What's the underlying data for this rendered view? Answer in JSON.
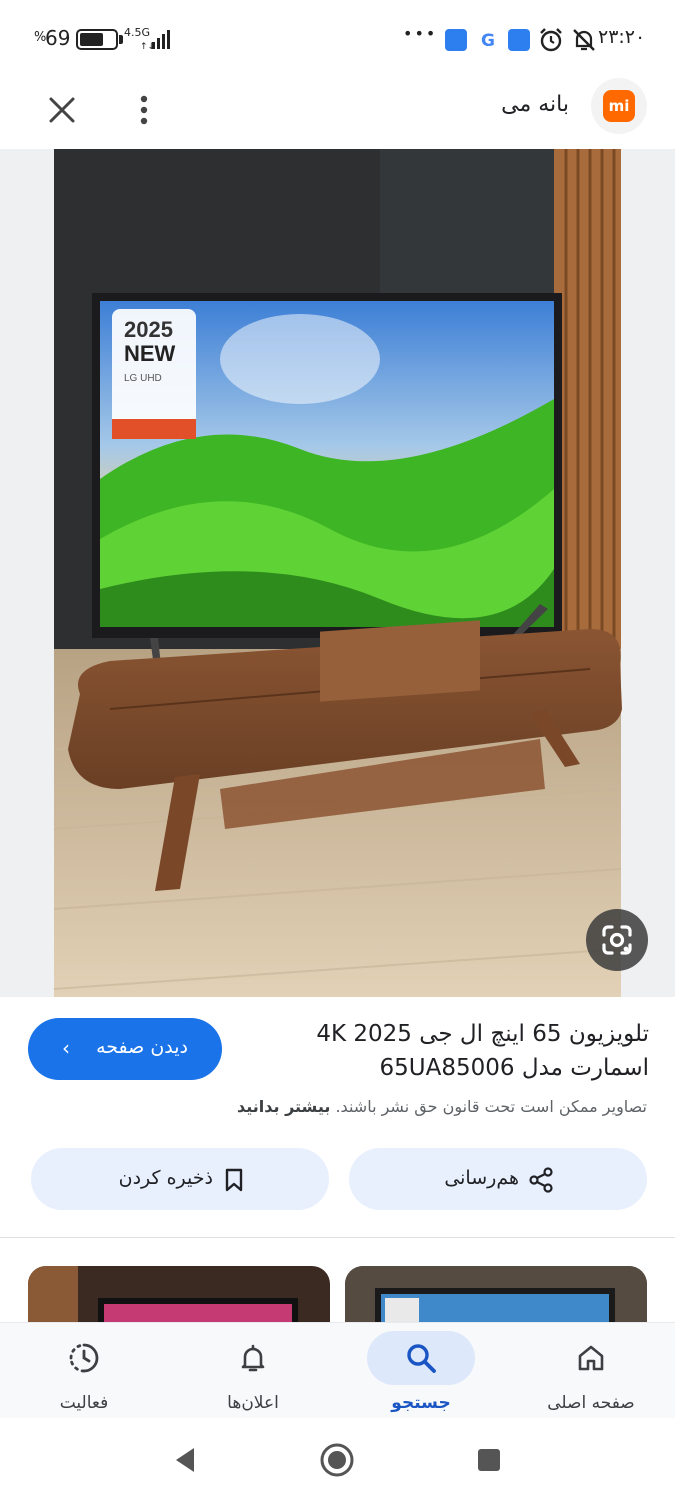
{
  "status_bar": {
    "battery_percent": "69",
    "percent_sign": "%",
    "battery_level": 0.69,
    "network_type": "4.5G",
    "overflow_dots": "•••",
    "time": "۲۳:۲۰",
    "icons": [
      "battery-icon",
      "signal-icon",
      "dots-icon",
      "app-notification-icon",
      "google-icon",
      "app-notification-icon",
      "alarm-icon",
      "mute-icon"
    ]
  },
  "header": {
    "site_name": "بانه می",
    "logo_text": "mi",
    "logo_color": "#ff6900"
  },
  "tv_image": {
    "screen_text_line1": "2025",
    "screen_text_line2": "NEW",
    "screen_text_line3": "LG UHD"
  },
  "result": {
    "title": "تلویزیون 65 اینچ ال جی 4K 2025 اسمارت مدل 65UA85006",
    "visit_label": "دیدن صفحه",
    "copyright_text": "تصاویر ممکن است تحت قانون حق نشر باشند.",
    "learn_more": "بیشتر بدانید",
    "share_label": "هم‌رسانی",
    "save_label": "ذخیره کردن"
  },
  "bottom_nav": {
    "items": [
      {
        "label": "صفحه اصلی",
        "icon": "home-icon"
      },
      {
        "label": "جستجو",
        "icon": "search-icon",
        "active": true
      },
      {
        "label": "اعلان‌ها",
        "icon": "bell-icon"
      },
      {
        "label": "فعالیت",
        "icon": "activity-icon"
      }
    ]
  },
  "colors": {
    "accent": "#1a73e8",
    "pill_bg": "#e8f0fe",
    "nav_active": "#1a55c4"
  }
}
